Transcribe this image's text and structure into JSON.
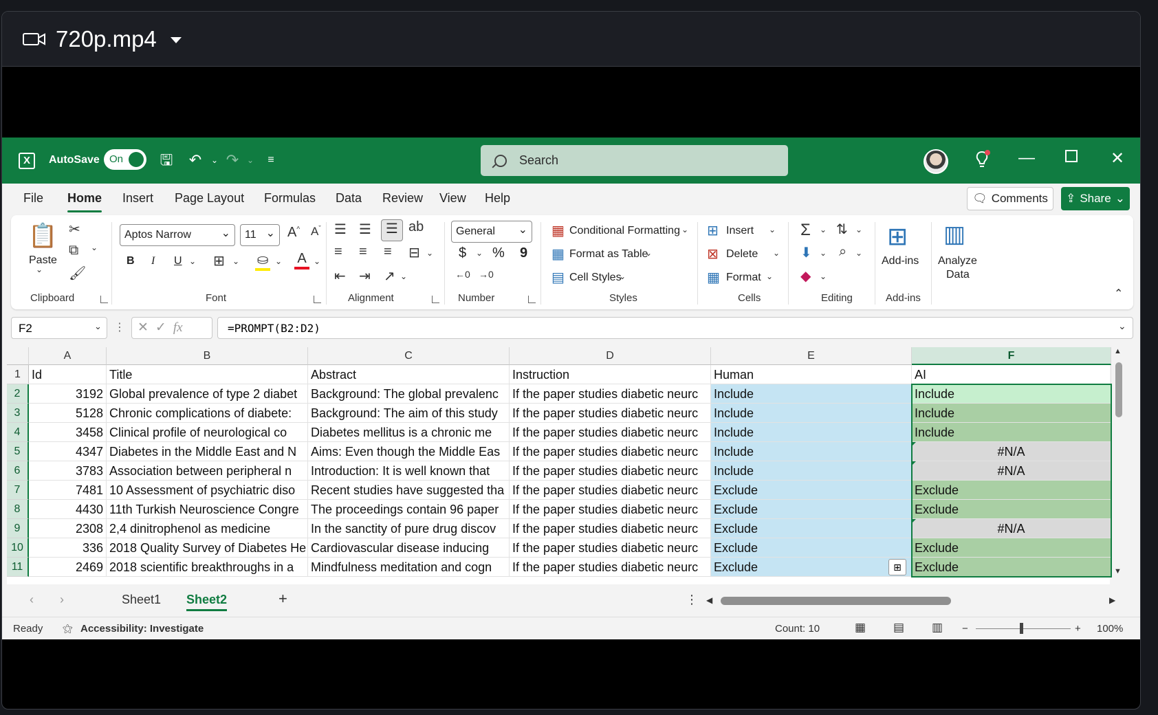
{
  "player": {
    "file_name": "720p.mp4",
    "camera_icon": "video-camera-icon"
  },
  "titlebar": {
    "autosave_label": "AutoSave",
    "autosave_state": "On",
    "search_placeholder": "Search"
  },
  "menu": {
    "tabs": [
      "File",
      "Home",
      "Insert",
      "Page Layout",
      "Formulas",
      "Data",
      "Review",
      "View",
      "Help"
    ],
    "active": "Home",
    "comments_label": "Comments",
    "share_label": "Share"
  },
  "ribbon": {
    "clipboard": {
      "label": "Clipboard",
      "paste": "Paste"
    },
    "font": {
      "label": "Font",
      "name": "Aptos Narrow",
      "size": "11",
      "bold": "B",
      "italic": "I",
      "underline": "U"
    },
    "alignment": {
      "label": "Alignment"
    },
    "number": {
      "label": "Number",
      "format": "General",
      "currency": "$",
      "percent": "%",
      "comma": "9"
    },
    "styles": {
      "label": "Styles",
      "conditional": "Conditional Formatting",
      "table": "Format as Table",
      "cell_styles": "Cell Styles"
    },
    "cells": {
      "label": "Cells",
      "insert": "Insert",
      "delete": "Delete",
      "format": "Format"
    },
    "editing": {
      "label": "Editing"
    },
    "addins": {
      "label": "Add-ins",
      "addins_btn": "Add-ins",
      "analyze": "Analyze",
      "analyze2": "Data"
    }
  },
  "formula_bar": {
    "name_box": "F2",
    "formula": "=PROMPT(B2:D2)",
    "fx": "fx"
  },
  "grid": {
    "columns": [
      "A",
      "B",
      "C",
      "D",
      "E",
      "F"
    ],
    "row_numbers": [
      "1",
      "2",
      "3",
      "4",
      "5",
      "6",
      "7",
      "8",
      "9",
      "10",
      "11"
    ],
    "header": [
      "Id",
      "Title",
      "Abstract",
      "Instruction",
      "Human",
      "AI"
    ],
    "rows": [
      [
        "3192",
        "Global prevalence of type 2 diabet",
        "Background: The global prevalenc",
        "If the paper studies diabetic neurc",
        "Include",
        "Include"
      ],
      [
        "5128",
        "Chronic complications of diabete:",
        "Background: The aim of this study",
        "If the paper studies diabetic neurc",
        "Include",
        "Include"
      ],
      [
        "3458",
        "Clinical profile of neurological co",
        "Diabetes mellitus is a chronic me",
        "If the paper studies diabetic neurc",
        "Include",
        "Include"
      ],
      [
        "4347",
        "Diabetes in the Middle East and N",
        "Aims: Even though the Middle Eas",
        "If the paper studies diabetic neurc",
        "Include",
        "#N/A"
      ],
      [
        "3783",
        "Association between peripheral n",
        "Introduction: It is well known that",
        "If the paper studies diabetic neurc",
        "Include",
        "#N/A"
      ],
      [
        "7481",
        "10 Assessment of psychiatric diso",
        "Recent studies have suggested tha",
        "If the paper studies diabetic neurc",
        "Exclude",
        "Exclude"
      ],
      [
        "4430",
        "11th Turkish Neuroscience Congre",
        "The proceedings contain 96 paper",
        "If the paper studies diabetic neurc",
        "Exclude",
        "Exclude"
      ],
      [
        "2308",
        "2,4 dinitrophenol as medicine",
        "In the sanctity of pure drug discov",
        "If the paper studies diabetic neurc",
        "Exclude",
        "#N/A"
      ],
      [
        "336",
        "2018 Quality Survey of Diabetes He",
        "Cardiovascular disease inducing",
        "If the paper studies diabetic neurc",
        "Exclude",
        "Exclude"
      ],
      [
        "2469",
        "2018 scientific breakthroughs in a",
        "Mindfulness meditation and cogn",
        "If the paper studies diabetic neurc",
        "Exclude",
        "Exclude"
      ]
    ]
  },
  "sheets": {
    "tabs": [
      "Sheet1",
      "Sheet2"
    ],
    "active": "Sheet2",
    "add": "+"
  },
  "status": {
    "ready": "Ready",
    "accessibility": "Accessibility: Investigate",
    "count": "Count: 10",
    "zoom": "100%",
    "zoom_minus": "−",
    "zoom_plus": "+"
  },
  "colors": {
    "excel_green": "#107c41",
    "human_fill": "#c5e4f3",
    "ai_fill": "#a9cfa4",
    "na_fill": "#d9d9d9"
  }
}
